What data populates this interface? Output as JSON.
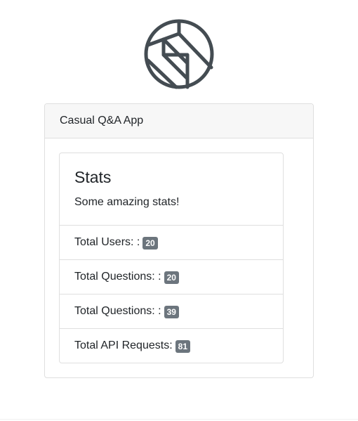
{
  "logo": {
    "icon": "app-logo-icon",
    "color": "#444c52"
  },
  "card": {
    "header": "Casual Q&A App",
    "stats": {
      "title": "Stats",
      "subtitle": "Some amazing stats!",
      "items": [
        {
          "label": "Total Users: :",
          "value": "20"
        },
        {
          "label": "Total Questions: :",
          "value": "20"
        },
        {
          "label": "Total Questions: :",
          "value": "39"
        },
        {
          "label": "Total API Requests:",
          "value": "81"
        }
      ]
    }
  },
  "colors": {
    "badge_bg": "#6c757d",
    "header_bg": "#f7f7f7",
    "border": "#dfdfdf"
  }
}
